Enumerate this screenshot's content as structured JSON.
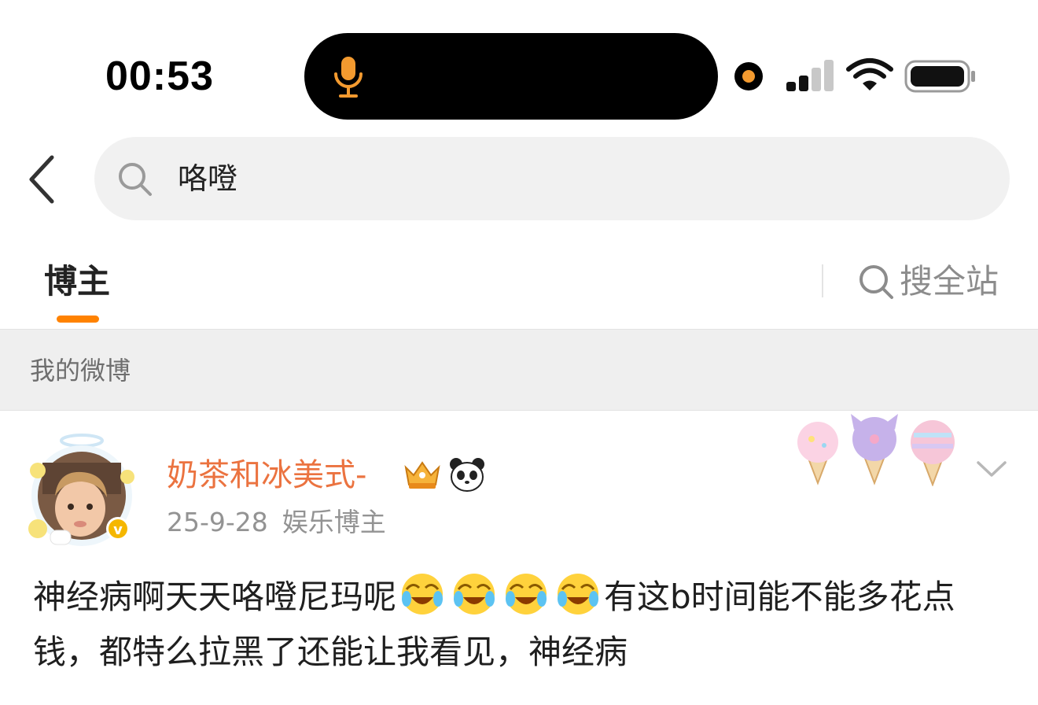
{
  "status_bar": {
    "time": "00:53",
    "icons": [
      "microphone-icon",
      "recording-dot",
      "signal-icon",
      "wifi-icon",
      "battery-icon"
    ],
    "mic_color": "#f39a2f"
  },
  "search": {
    "back_icon": "chevron-left-icon",
    "icon": "search-icon",
    "query": "咯噔"
  },
  "tabs": {
    "active": "博主",
    "accent": "#ff8200",
    "search_site_label": "搜全站"
  },
  "section": {
    "label": "我的微博"
  },
  "post": {
    "username": "奶茶和冰美式-",
    "username_color": "#eb7340",
    "badges": [
      "crown-badge-icon",
      "panda-icon"
    ],
    "date": "25-9-28",
    "category": "娱乐博主",
    "decoration": "ice-cream-decoration",
    "text_part1": "神经病啊天天咯噔尼玛呢",
    "emojis": [
      "laugh-cry-emoji",
      "laugh-cry-emoji",
      "laugh-cry-emoji",
      "laugh-cry-emoji"
    ],
    "text_part2": "有这b时间能不能多花点钱，都特么拉黑了还能让我看见，神经病"
  }
}
